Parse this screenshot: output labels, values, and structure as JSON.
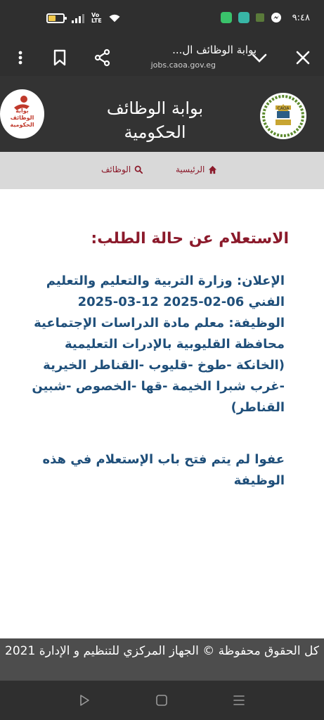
{
  "status_bar": {
    "volte_label": "Vo LTE",
    "time": "٩:٤٨"
  },
  "browser": {
    "page_title": "بوابة الوظائف ال...",
    "domain": "jobs.caoa.gov.eg"
  },
  "site": {
    "title_line1": "بوابة الوظائف",
    "title_line2": "الحكومية",
    "logo_text_line1": "بوابة",
    "logo_text_line2": "الوظائف",
    "logo_text_line3": "الحكومية",
    "emblem_text": "CAOA"
  },
  "nav": {
    "home_label": "الرئيسية",
    "jobs_label": "الوظائف"
  },
  "main": {
    "heading": "الاستعلام عن حالة الطلب:",
    "announcement": "الإعلان: وزارة التربية والتعليم والتعليم الفني 06-02-2025 12-03-2025",
    "job": "الوظيفة: معلم مادة الدراسات الإجتماعية محافظة القليوبية بالإدرات التعليمية (الخانكة -طوخ -قليوب -القناطر الخيرية -غرب شبرا الخيمة -قها -الخصوص -شبين القناطر)",
    "notice": "عفوا لم يتم فتح باب الإستعلام في هذه الوظيفة"
  },
  "footer": {
    "text": "كل الحقوق محفوظة © الجهاز المركزي للتنظيم و الإدارة 2021"
  },
  "colors": {
    "accent": "#8b1a2b",
    "body_text": "#1f4f7a",
    "header_bg": "#333333",
    "nav_bg": "#d9d9d9"
  }
}
